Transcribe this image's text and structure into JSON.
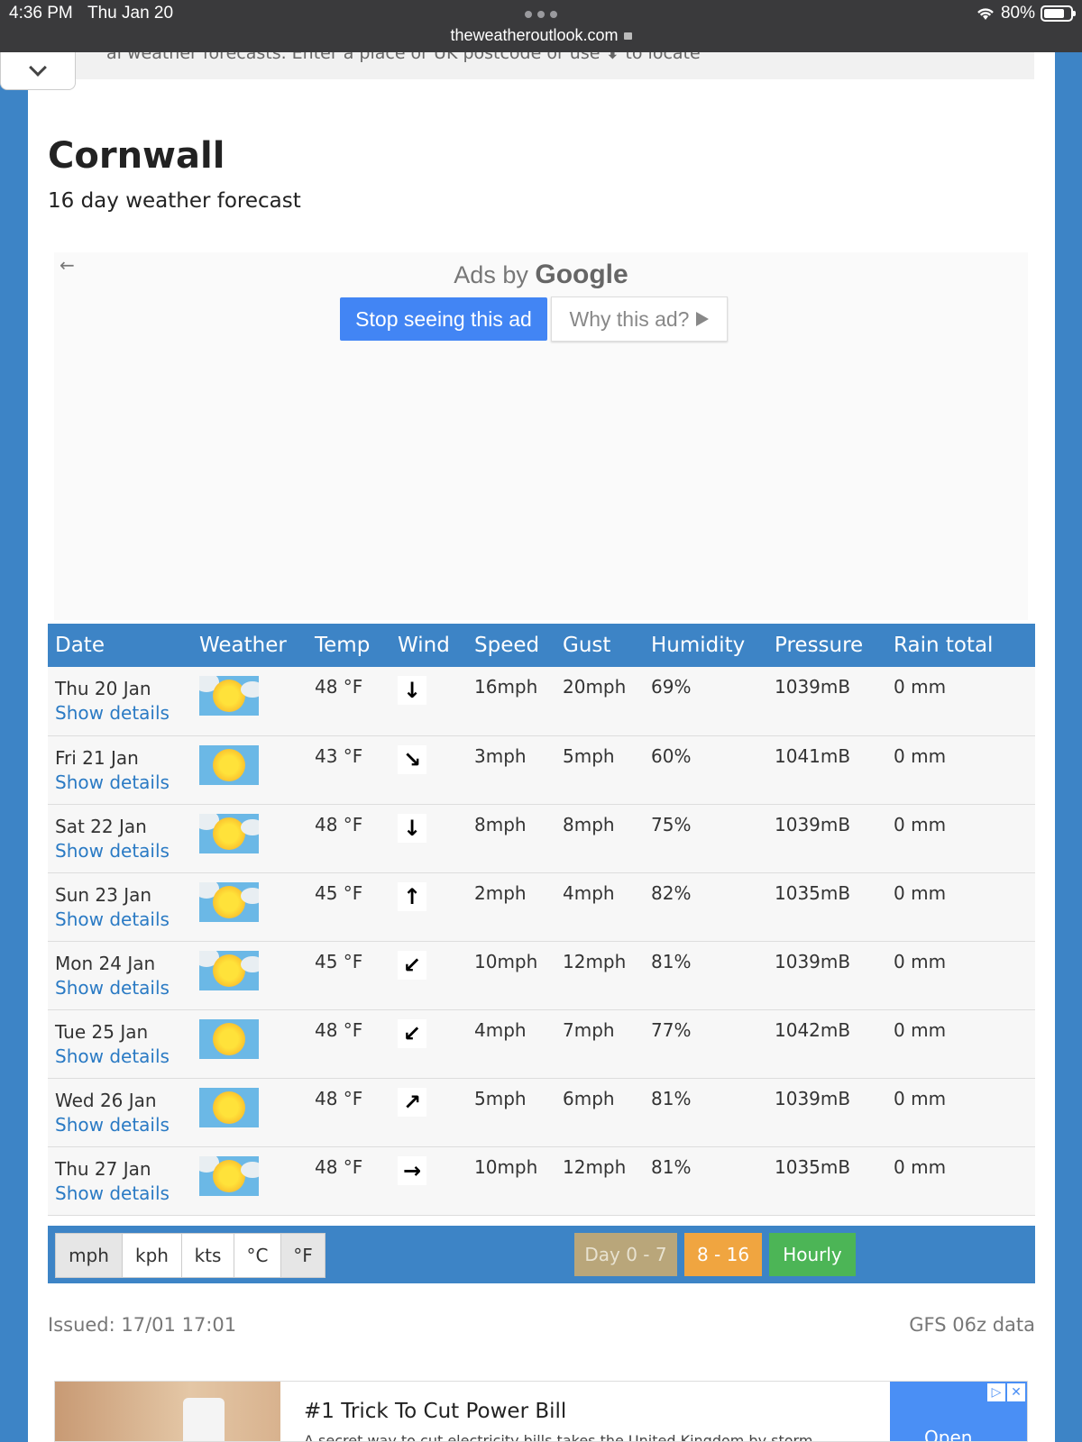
{
  "status_bar": {
    "time": "4:36 PM",
    "date": "Thu Jan 20",
    "url": "theweatheroutlook.com",
    "battery": "80%"
  },
  "page": {
    "top_strip_text": "al weather forecasts. Enter a place or UK postcode or use ⬇ to locate",
    "title": "Cornwall",
    "subtitle": "16 day weather forecast"
  },
  "ad": {
    "ads_by": "Ads by",
    "google": "Google",
    "stop_label": "Stop seeing this ad",
    "why_label": "Why this ad?"
  },
  "table": {
    "headers": [
      "Date",
      "Weather",
      "Temp",
      "Wind",
      "Speed",
      "Gust",
      "Humidity",
      "Pressure",
      "Rain total"
    ],
    "rows": [
      {
        "date": "Thu 20 Jan",
        "link": "Show details",
        "weather": "sunny-intervals-icon",
        "temp": "48 °F",
        "wind": "↓",
        "wind_name": "wind-south-arrow",
        "speed": "16mph",
        "gust": "20mph",
        "humidity": "69%",
        "pressure": "1039mB",
        "rain": "0 mm"
      },
      {
        "date": "Fri 21 Jan",
        "link": "Show details",
        "weather": "sunny-icon",
        "temp": "43 °F",
        "wind": "↘",
        "wind_name": "wind-southeast-arrow",
        "speed": "3mph",
        "gust": "5mph",
        "humidity": "60%",
        "pressure": "1041mB",
        "rain": "0 mm"
      },
      {
        "date": "Sat 22 Jan",
        "link": "Show details",
        "weather": "sunny-intervals-icon",
        "temp": "48 °F",
        "wind": "↓",
        "wind_name": "wind-south-arrow",
        "speed": "8mph",
        "gust": "8mph",
        "humidity": "75%",
        "pressure": "1039mB",
        "rain": "0 mm"
      },
      {
        "date": "Sun 23 Jan",
        "link": "Show details",
        "weather": "sunny-intervals-icon",
        "temp": "45 °F",
        "wind": "↑",
        "wind_name": "wind-north-arrow",
        "speed": "2mph",
        "gust": "4mph",
        "humidity": "82%",
        "pressure": "1035mB",
        "rain": "0 mm"
      },
      {
        "date": "Mon 24 Jan",
        "link": "Show details",
        "weather": "sunny-intervals-icon",
        "temp": "45 °F",
        "wind": "↙",
        "wind_name": "wind-southwest-arrow",
        "speed": "10mph",
        "gust": "12mph",
        "humidity": "81%",
        "pressure": "1039mB",
        "rain": "0 mm"
      },
      {
        "date": "Tue 25 Jan",
        "link": "Show details",
        "weather": "sunny-icon",
        "temp": "48 °F",
        "wind": "↙",
        "wind_name": "wind-southwest-arrow",
        "speed": "4mph",
        "gust": "7mph",
        "humidity": "77%",
        "pressure": "1042mB",
        "rain": "0 mm"
      },
      {
        "date": "Wed 26 Jan",
        "link": "Show details",
        "weather": "sunny-icon",
        "temp": "48 °F",
        "wind": "↗",
        "wind_name": "wind-northeast-arrow",
        "speed": "5mph",
        "gust": "6mph",
        "humidity": "81%",
        "pressure": "1039mB",
        "rain": "0 mm"
      },
      {
        "date": "Thu 27 Jan",
        "link": "Show details",
        "weather": "sunny-intervals-icon",
        "temp": "48 °F",
        "wind": "→",
        "wind_name": "wind-east-arrow",
        "speed": "10mph",
        "gust": "12mph",
        "humidity": "81%",
        "pressure": "1035mB",
        "rain": "0 mm"
      }
    ]
  },
  "units": {
    "options": [
      "mph",
      "kph",
      "kts",
      "°C",
      "°F"
    ],
    "active": [
      "mph",
      "°F"
    ]
  },
  "ranges": [
    {
      "label": "Day 0 - 7",
      "color": "#b9a67a"
    },
    {
      "label": "8 - 16",
      "color": "#f0a540"
    },
    {
      "label": "Hourly",
      "color": "#4cb556"
    }
  ],
  "footer": {
    "issued": "Issued: 17/01 17:01",
    "source": "GFS 06z data"
  },
  "bottom_ad": {
    "title": "#1 Trick To Cut Power Bill",
    "desc": "A secret way to cut electricity bills takes the United Kingdom by storm",
    "open_label": "Open"
  },
  "colors": {
    "accent": "#3d84c6",
    "link": "#2a7ac4"
  }
}
